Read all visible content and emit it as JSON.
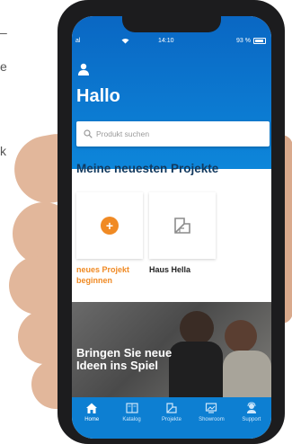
{
  "background": {
    "fragments": [
      "–",
      "e",
      "k"
    ]
  },
  "status_bar": {
    "carrier": "al",
    "time": "14:10",
    "battery": "93 %"
  },
  "header": {
    "greeting": "Hallo"
  },
  "search": {
    "placeholder": "Produkt suchen"
  },
  "projects": {
    "title": "Meine neuesten Projekte",
    "cards": [
      {
        "label": "neues Projekt beginnen",
        "icon": "plus-icon"
      },
      {
        "label": "Haus Hella",
        "icon": "floor-plan-icon"
      }
    ]
  },
  "banner": {
    "text": "Bringen Sie neue Ideen ins Spiel"
  },
  "tabbar": {
    "tabs": [
      {
        "label": "Home",
        "icon": "home-icon",
        "active": true
      },
      {
        "label": "Katalog",
        "icon": "catalog-icon",
        "active": false
      },
      {
        "label": "Projekte",
        "icon": "projects-icon",
        "active": false
      },
      {
        "label": "Showroom",
        "icon": "showroom-icon",
        "active": false
      },
      {
        "label": "Support",
        "icon": "support-icon",
        "active": false
      }
    ]
  },
  "colors": {
    "primary_blue": "#0d7fd2",
    "accent_orange": "#f08a24",
    "title_navy": "#12395e"
  }
}
